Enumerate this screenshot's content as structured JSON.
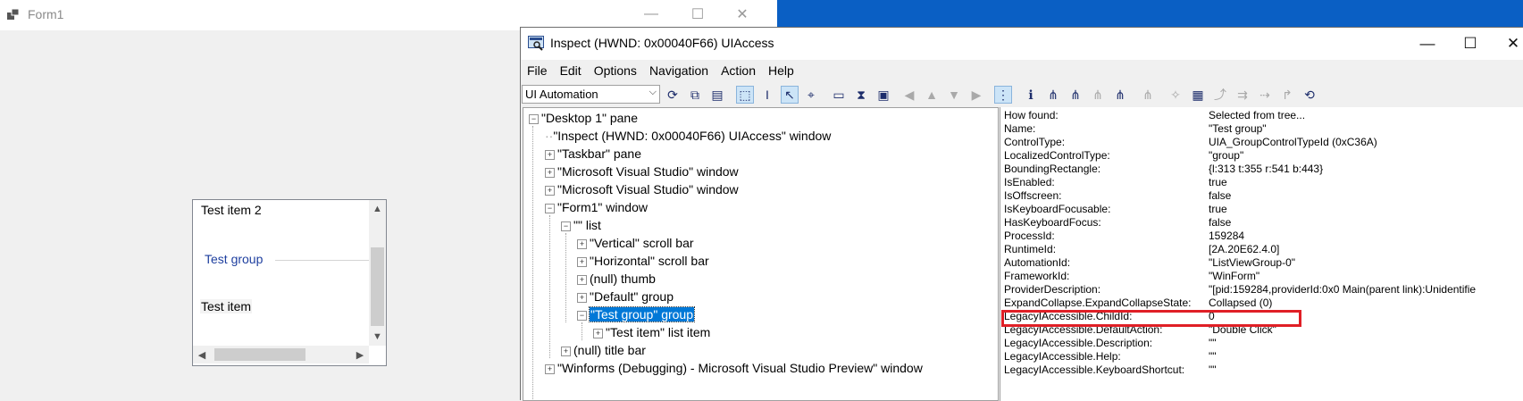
{
  "form1": {
    "title": "Form1",
    "list": {
      "item2": "Test item 2",
      "group": "Test group",
      "item": "Test item"
    }
  },
  "inspect": {
    "title": "Inspect  (HWND: 0x00040F66) UIAccess",
    "menu": [
      "File",
      "Edit",
      "Options",
      "Navigation",
      "Action",
      "Help"
    ],
    "mode_select": "UI Automation",
    "tree": [
      "\"Desktop 1\" pane",
      "\"Inspect  (HWND: 0x00040F66) UIAccess\" window",
      "\"Taskbar\" pane",
      "\"Microsoft Visual Studio\" window",
      "\"Microsoft Visual Studio\" window",
      "\"Form1\" window",
      "\"\" list",
      "\"Vertical\" scroll bar",
      "\"Horizontal\" scroll bar",
      "(null) thumb",
      "\"Default\" group",
      "\"Test group\" group",
      "\"Test item\" list item",
      "(null) title bar",
      "\"Winforms (Debugging) - Microsoft Visual Studio Preview\" window"
    ],
    "properties": [
      [
        "How found:",
        "Selected from tree..."
      ],
      [
        "Name:",
        "\"Test group\""
      ],
      [
        "ControlType:",
        "UIA_GroupControlTypeId (0xC36A)"
      ],
      [
        "LocalizedControlType:",
        "\"group\""
      ],
      [
        "BoundingRectangle:",
        "{l:313 t:355 r:541 b:443}"
      ],
      [
        "IsEnabled:",
        "true"
      ],
      [
        "IsOffscreen:",
        "false"
      ],
      [
        "IsKeyboardFocusable:",
        "true"
      ],
      [
        "HasKeyboardFocus:",
        "false"
      ],
      [
        "ProcessId:",
        "159284"
      ],
      [
        "RuntimeId:",
        "[2A.20E62.4.0]"
      ],
      [
        "AutomationId:",
        "\"ListViewGroup-0\""
      ],
      [
        "FrameworkId:",
        "\"WinForm\""
      ],
      [
        "ProviderDescription:",
        "\"[pid:159284,providerId:0x0 Main(parent link):Unidentifie"
      ],
      [
        "ExpandCollapse.ExpandCollapseState:",
        "Collapsed (0)"
      ],
      [
        "LegacyIAccessible.ChildId:",
        "0"
      ],
      [
        "LegacyIAccessible.DefaultAction:",
        "\"Double Click\""
      ],
      [
        "LegacyIAccessible.Description:",
        "\"\""
      ],
      [
        "LegacyIAccessible.Help:",
        "\"\""
      ],
      [
        "LegacyIAccessible.KeyboardShortcut:",
        "\"\""
      ]
    ]
  },
  "colors": {
    "selection": "#0078d7",
    "highlight_box": "#e01f26",
    "group_text": "#1e3f9f",
    "desktop": "#0a5fc4"
  }
}
